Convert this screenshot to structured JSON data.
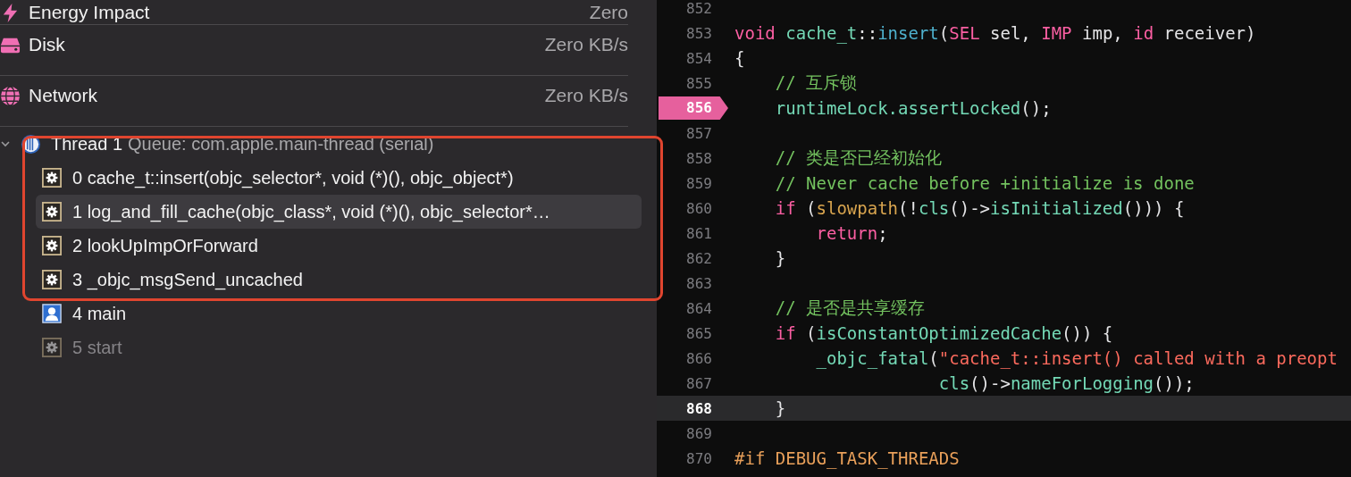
{
  "gauges": [
    {
      "kind": "energy",
      "label": "Energy Impact",
      "value": "Zero"
    },
    {
      "kind": "disk",
      "label": "Disk",
      "value": "Zero KB/s"
    },
    {
      "kind": "network",
      "label": "Network",
      "value": "Zero KB/s"
    }
  ],
  "thread": {
    "expanded": true,
    "name": "Thread 1",
    "queue": "Queue: com.apple.main-thread (serial)",
    "frames": [
      {
        "kind": "gear",
        "label": "0 cache_t::insert(objc_selector*, void (*)(), objc_object*)",
        "selected": false,
        "dimmed": false
      },
      {
        "kind": "gear",
        "label": "1 log_and_fill_cache(objc_class*, void (*)(), objc_selector*…",
        "selected": true,
        "dimmed": false
      },
      {
        "kind": "gear",
        "label": "2 lookUpImpOrForward",
        "selected": false,
        "dimmed": false
      },
      {
        "kind": "gear",
        "label": "3 _objc_msgSend_uncached",
        "selected": false,
        "dimmed": false
      },
      {
        "kind": "user",
        "label": "4 main",
        "selected": false,
        "dimmed": false
      },
      {
        "kind": "gear",
        "label": "5 start",
        "selected": false,
        "dimmed": true
      }
    ]
  },
  "code": [
    {
      "n": "852",
      "breakpoint": false,
      "current": false
    },
    {
      "n": "853",
      "breakpoint": false,
      "current": false,
      "tokens": [
        {
          "kind": "keyword",
          "text": "void "
        },
        {
          "kind": "proj",
          "text": "cache_t"
        },
        {
          "kind": "plain",
          "text": "::"
        },
        {
          "kind": "method",
          "text": "insert"
        },
        {
          "kind": "plain",
          "text": "("
        },
        {
          "kind": "keyword",
          "text": "SEL"
        },
        {
          "kind": "plain",
          "text": " sel, "
        },
        {
          "kind": "keyword",
          "text": "IMP"
        },
        {
          "kind": "plain",
          "text": " imp, "
        },
        {
          "kind": "keyword",
          "text": "id"
        },
        {
          "kind": "plain",
          "text": " receiver)"
        }
      ]
    },
    {
      "n": "854",
      "breakpoint": false,
      "current": false,
      "tokens": [
        {
          "kind": "plain",
          "text": "{"
        }
      ]
    },
    {
      "n": "855",
      "breakpoint": false,
      "current": false,
      "tokens": [
        {
          "kind": "comment",
          "text": "    // 互斥锁"
        }
      ]
    },
    {
      "n": "856",
      "breakpoint": true,
      "current": false,
      "tokens": [
        {
          "kind": "proj",
          "text": "    runtimeLock.assertLocked"
        },
        {
          "kind": "plain",
          "text": "();"
        }
      ]
    },
    {
      "n": "857",
      "breakpoint": false,
      "current": false
    },
    {
      "n": "858",
      "breakpoint": false,
      "current": false,
      "tokens": [
        {
          "kind": "comment",
          "text": "    // 类是否已经初始化"
        }
      ]
    },
    {
      "n": "859",
      "breakpoint": false,
      "current": false,
      "tokens": [
        {
          "kind": "comment",
          "text": "    // Never cache before +initialize is done"
        }
      ]
    },
    {
      "n": "860",
      "breakpoint": false,
      "current": false,
      "tokens": [
        {
          "kind": "keyword",
          "text": "    if"
        },
        {
          "kind": "plain",
          "text": " ("
        },
        {
          "kind": "macro",
          "text": "slowpath"
        },
        {
          "kind": "plain",
          "text": "(!"
        },
        {
          "kind": "proj",
          "text": "cls"
        },
        {
          "kind": "plain",
          "text": "()->"
        },
        {
          "kind": "proj",
          "text": "isInitialized"
        },
        {
          "kind": "plain",
          "text": "())) {"
        }
      ]
    },
    {
      "n": "861",
      "breakpoint": false,
      "current": false,
      "tokens": [
        {
          "kind": "keyword",
          "text": "        return"
        },
        {
          "kind": "plain",
          "text": ";"
        }
      ]
    },
    {
      "n": "862",
      "breakpoint": false,
      "current": false,
      "tokens": [
        {
          "kind": "plain",
          "text": "    }"
        }
      ]
    },
    {
      "n": "863",
      "breakpoint": false,
      "current": false
    },
    {
      "n": "864",
      "breakpoint": false,
      "current": false,
      "tokens": [
        {
          "kind": "comment",
          "text": "    // 是否是共享缓存"
        }
      ]
    },
    {
      "n": "865",
      "breakpoint": false,
      "current": false,
      "tokens": [
        {
          "kind": "keyword",
          "text": "    if"
        },
        {
          "kind": "plain",
          "text": " ("
        },
        {
          "kind": "proj",
          "text": "isConstantOptimizedCache"
        },
        {
          "kind": "plain",
          "text": "()) {"
        }
      ]
    },
    {
      "n": "866",
      "breakpoint": false,
      "current": false,
      "tokens": [
        {
          "kind": "proj",
          "text": "        _objc_fatal"
        },
        {
          "kind": "plain",
          "text": "("
        },
        {
          "kind": "string",
          "text": "\"cache_t::insert() called with a preopt"
        }
      ]
    },
    {
      "n": "867",
      "breakpoint": false,
      "current": false,
      "tokens": [
        {
          "kind": "proj",
          "text": "                    cls"
        },
        {
          "kind": "plain",
          "text": "()->"
        },
        {
          "kind": "proj",
          "text": "nameForLogging"
        },
        {
          "kind": "plain",
          "text": "());"
        }
      ]
    },
    {
      "n": "868",
      "breakpoint": false,
      "current": true,
      "tokens": [
        {
          "kind": "plain",
          "text": "    }"
        }
      ]
    },
    {
      "n": "869",
      "breakpoint": false,
      "current": false
    },
    {
      "n": "870",
      "breakpoint": false,
      "current": false,
      "tokens": [
        {
          "kind": "preproc",
          "text": "#if DEBUG_TASK_THREADS"
        }
      ]
    }
  ]
}
